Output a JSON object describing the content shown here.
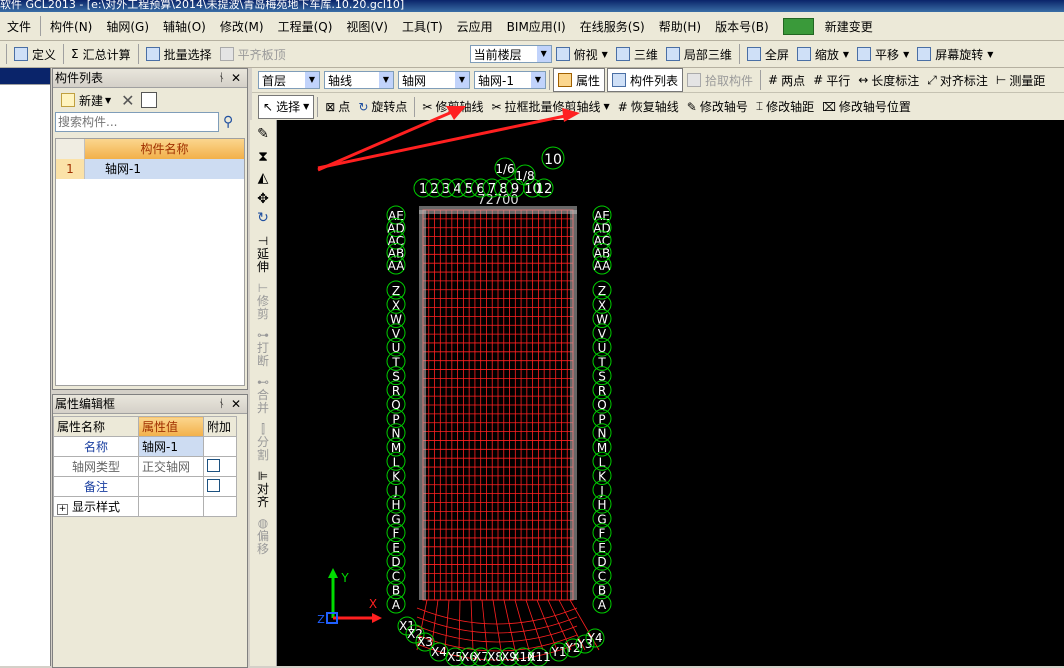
{
  "window": {
    "title": "软件 GCL2013 - [e:\\对外工程预算\\2014\\未提波\\青岛梅苑地下车库.10.20.gcl10]"
  },
  "menu": [
    "文件",
    "构件(N)",
    "轴网(G)",
    "辅轴(O)",
    "修改(M)",
    "工程量(Q)",
    "视图(V)",
    "工具(T)",
    "云应用",
    "BIM应用(I)",
    "在线服务(S)",
    "帮助(H)",
    "版本号(B)",
    "新建变更"
  ],
  "toolbar1": {
    "define": "定义",
    "summary": "汇总计算",
    "batch_select": "批量选择",
    "flush_slab": "平齐板顶",
    "floor_label": "当前楼层",
    "top_view": "俯视",
    "three_d": "三维",
    "local_3d": "局部三维",
    "full_screen": "全屏",
    "zoom": "缩放",
    "pan": "平移",
    "rotate": "屏幕旋转"
  },
  "component_list": {
    "title": "构件列表",
    "new_label": "新建",
    "search_placeholder": "搜索构件...",
    "column": "构件名称",
    "rows": [
      {
        "index": "1",
        "name": "轴网-1"
      }
    ]
  },
  "property_box": {
    "title": "属性编辑框",
    "headers": [
      "属性名称",
      "属性值",
      "附加"
    ],
    "rows": [
      {
        "name": "名称",
        "value": "轴网-1"
      },
      {
        "name": "轴网类型",
        "value": "正交轴网"
      },
      {
        "name": "备注",
        "value": ""
      },
      {
        "name": "显示样式",
        "value": ""
      }
    ]
  },
  "toolbar2": {
    "floor": "首层",
    "type": "轴线",
    "subtype": "轴网",
    "instance": "轴网-1",
    "property": "属性",
    "comp_list": "构件列表",
    "pick": "拾取构件",
    "two_points": "两点",
    "parallel": "平行",
    "length_dim": "长度标注",
    "align_dim": "对齐标注",
    "measure": "测量距"
  },
  "toolbar3": {
    "select": "选择",
    "point": "点",
    "rotate_point": "旋转点",
    "trim_axis": "修剪轴线",
    "box_trim": "拉框批量修剪轴线",
    "restore_axis": "恢复轴线",
    "modify_axis_no": "修改轴号",
    "modify_axis_dist": "修改轴距",
    "modify_axis_pos": "修改轴号位置"
  },
  "vertical_tools": [
    "延伸",
    "修剪",
    "打断",
    "合并",
    "分割",
    "对齐",
    "偏移"
  ],
  "drawing": {
    "top_numbers": [
      "1",
      "2",
      "3",
      "4",
      "5",
      "6",
      "7",
      "8",
      "9",
      "10",
      "12"
    ],
    "top_extra": [
      "10",
      "1/6",
      "1/8"
    ],
    "dimension": "72700",
    "left_letters": [
      "AE",
      "AD",
      "AC",
      "AB",
      "AA",
      "Z",
      "X",
      "W",
      "V",
      "U",
      "T",
      "S",
      "R",
      "Q",
      "P",
      "N",
      "M",
      "L",
      "K",
      "J",
      "H",
      "G",
      "F",
      "E",
      "D",
      "C",
      "B",
      "A"
    ],
    "bottom_labels": [
      "X1",
      "X2",
      "X3",
      "X4",
      "X5",
      "X6",
      "X7",
      "X8",
      "X9",
      "X10",
      "X11",
      "Y1",
      "Y2",
      "Y3",
      "Y4"
    ],
    "axis_x": "X",
    "axis_y": "Y",
    "axis_z": "Z",
    "colors": {
      "grid": "#ff2020",
      "bubble": "#00cc00",
      "text": "#ffffff",
      "arrow": "#ff0000",
      "background": "#000000"
    }
  }
}
